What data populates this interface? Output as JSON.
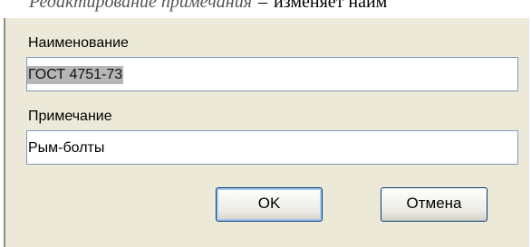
{
  "document": {
    "italic_text": "Редактирование примечания",
    "dash": "–",
    "rest_text": "изменяет наим"
  },
  "dialog": {
    "name_label": "Наименование",
    "name_value": "ГОСТ 4751-73",
    "note_label": "Примечание",
    "note_value": "Рым-болты",
    "ok_label": "OK",
    "cancel_label": "Отмена"
  }
}
